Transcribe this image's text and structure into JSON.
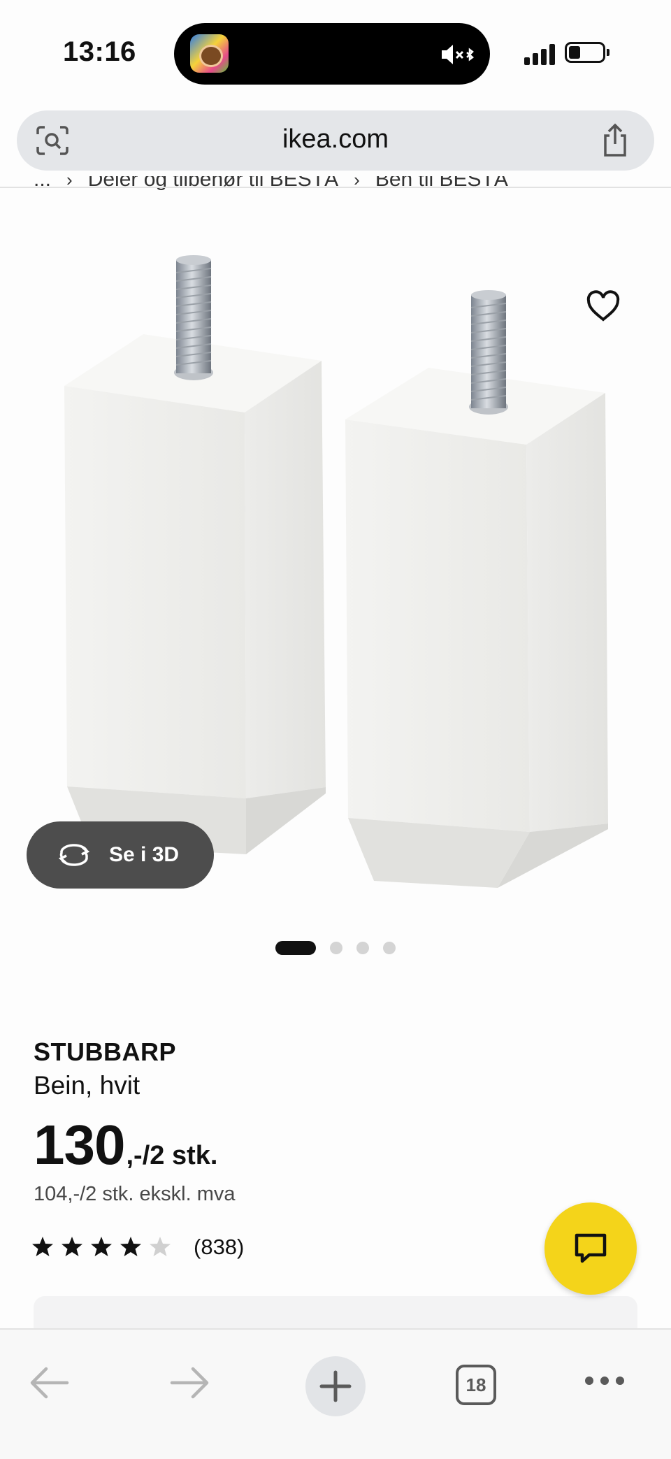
{
  "status_bar": {
    "time": "13:16"
  },
  "browser": {
    "url": "ikea.com",
    "tab_count": "18"
  },
  "breadcrumb": {
    "items": [
      "...",
      "Deler og tilbehør til BESTÅ",
      "Ben til BESTÅ"
    ]
  },
  "gallery": {
    "view_3d_label": "Se i 3D",
    "image_count": 4,
    "active_index": 1
  },
  "product": {
    "name": "STUBBARP",
    "description": "Bein, hvit",
    "price_main": "130",
    "price_suffix": ",-/2 stk.",
    "price_ex_vat": "104,-/2 stk. ekskl. mva",
    "rating_stars": 4.5,
    "rating_max": 5,
    "review_count": "(838)"
  },
  "colors": {
    "chat_button": "#f4d41a",
    "view_3d_button": "#4d4d4d",
    "url_bar": "#e4e6e9"
  },
  "icons": {
    "lens": "visual-search-icon",
    "share": "share-icon",
    "favourite": "heart-icon",
    "rotate": "rotate-3d-icon",
    "chat": "chat-icon",
    "back": "arrow-left-icon",
    "forward": "arrow-right-icon",
    "new_tab": "plus-icon",
    "more": "more-icon"
  }
}
